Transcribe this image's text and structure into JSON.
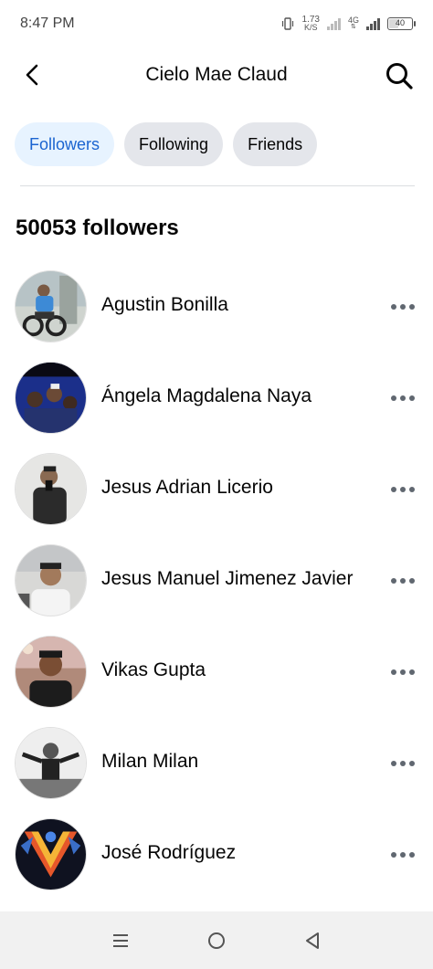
{
  "status_bar": {
    "time": "8:47 PM",
    "speed_value": "1.73",
    "speed_unit": "K/S",
    "network": "4G",
    "battery": "40"
  },
  "header": {
    "title": "Cielo Mae Claud",
    "back_icon": "chevron-left-icon",
    "search_icon": "search-icon"
  },
  "tabs": [
    {
      "label": "Followers",
      "active": true
    },
    {
      "label": "Following",
      "active": false
    },
    {
      "label": "Friends",
      "active": false
    }
  ],
  "followers_count_label": "50053 followers",
  "followers": [
    {
      "name": "Agustin Bonilla"
    },
    {
      "name": "Ángela Magdalena Naya"
    },
    {
      "name": "Jesus Adrian Licerio"
    },
    {
      "name": "Jesus Manuel Jimenez Javier"
    },
    {
      "name": "Vikas Gupta"
    },
    {
      "name": "Milan Milan"
    },
    {
      "name": "José Rodríguez"
    }
  ],
  "nav_bar": {
    "menu_icon": "menu-icon",
    "home_icon": "home-circle-icon",
    "back_icon": "back-triangle-icon"
  },
  "colors": {
    "accent": "#1b64d0",
    "active_tab_bg": "#e7f3ff",
    "tab_bg": "#e4e6eb"
  }
}
